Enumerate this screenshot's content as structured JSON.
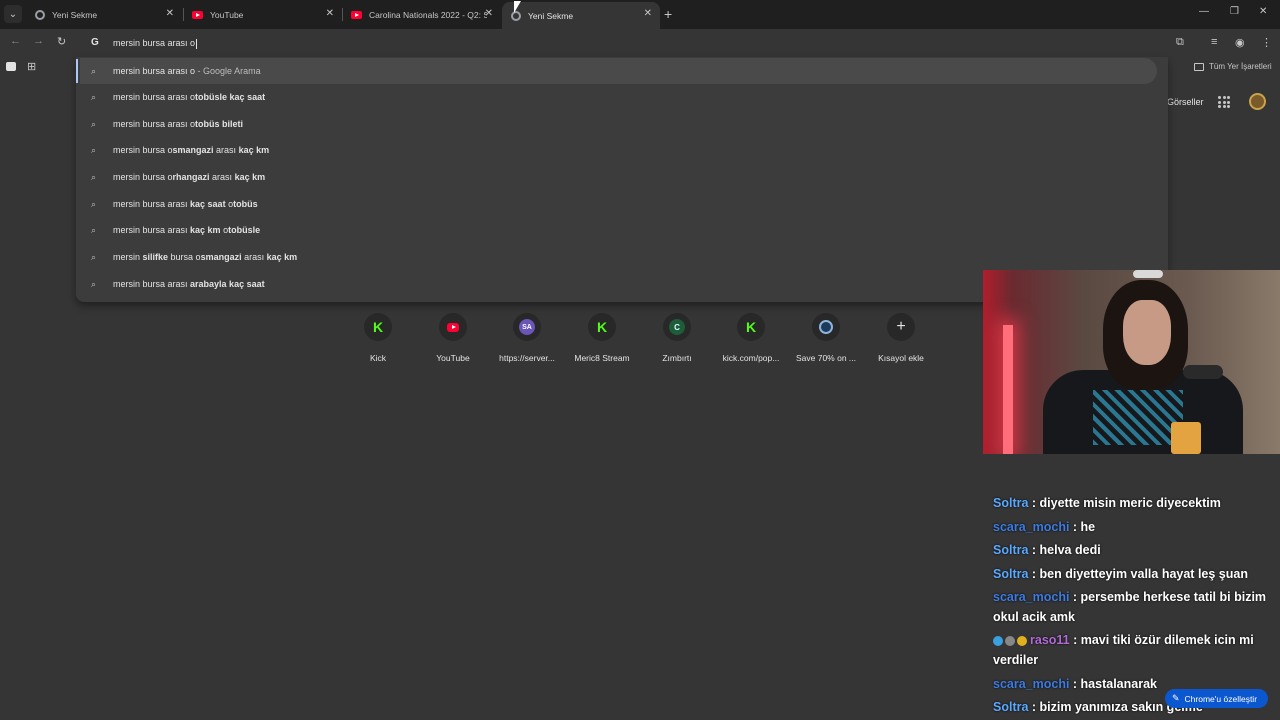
{
  "tabs": [
    {
      "title": "Yeni Sekme",
      "icon": "chrome-icon"
    },
    {
      "title": "YouTube",
      "icon": "youtube-icon"
    },
    {
      "title": "Carolina Nationals 2022 - Q2: S",
      "icon": "youtube-icon"
    },
    {
      "title": "Yeni Sekme",
      "icon": "chrome-icon",
      "active": true
    }
  ],
  "omnibox": {
    "value": "mersin bursa arası o"
  },
  "bookmarks": {
    "all_label": "Tüm Yer İşaretleri"
  },
  "google": {
    "images_label": "Görseller"
  },
  "suggestions": [
    {
      "pre": "mersin bursa arası o",
      "bold": "",
      "mid": "",
      "bold2": "",
      "mid2": "",
      "bold3": "",
      "suffix": " - Google Arama"
    },
    {
      "pre": "mersin bursa arası o",
      "bold": "tobüsle kaç saat",
      "mid": "",
      "bold2": "",
      "mid2": "",
      "bold3": "",
      "suffix": ""
    },
    {
      "pre": "mersin bursa arası o",
      "bold": "tobüs bileti",
      "mid": "",
      "bold2": "",
      "mid2": "",
      "bold3": "",
      "suffix": ""
    },
    {
      "pre": "mersin bursa o",
      "bold": "smangazi",
      "mid": " arası ",
      "bold2": "kaç km",
      "mid2": "",
      "bold3": "",
      "suffix": ""
    },
    {
      "pre": "mersin bursa o",
      "bold": "rhangazi",
      "mid": " arası ",
      "bold2": "kaç km",
      "mid2": "",
      "bold3": "",
      "suffix": ""
    },
    {
      "pre": "mersin bursa arası ",
      "bold": "kaç saat",
      "mid": " o",
      "bold2": "tobüs",
      "mid2": "",
      "bold3": "",
      "suffix": ""
    },
    {
      "pre": "mersin bursa arası ",
      "bold": "kaç km",
      "mid": " o",
      "bold2": "tobüsle",
      "mid2": "",
      "bold3": "",
      "suffix": ""
    },
    {
      "pre": "mersin ",
      "bold": "silifke",
      "mid": " bursa o",
      "bold2": "smangazi",
      "mid2": " arası ",
      "bold3": "kaç km",
      "suffix": ""
    },
    {
      "pre": "mersin bursa arası ",
      "bold": "arabayla kaç saat",
      "mid": "",
      "bold2": "",
      "mid2": "",
      "bold3": "",
      "suffix": ""
    }
  ],
  "shortcuts": [
    {
      "label": "Kick",
      "icon": "kick-icon",
      "glyph": "K"
    },
    {
      "label": "YouTube",
      "icon": "youtube-icon",
      "glyph": ""
    },
    {
      "label": "https://server...",
      "icon": "sa-icon",
      "glyph": "SA"
    },
    {
      "label": "Meric8 Stream",
      "icon": "kick-icon",
      "glyph": "K"
    },
    {
      "label": "Zımbırtı",
      "icon": "c-icon",
      "glyph": "C"
    },
    {
      "label": "kick.com/pop...",
      "icon": "kick-icon",
      "glyph": "K"
    },
    {
      "label": "Save 70% on ...",
      "icon": "steam-icon",
      "glyph": ""
    },
    {
      "label": "Kısayol ekle",
      "icon": "plus-icon",
      "glyph": "+"
    }
  ],
  "chat": [
    {
      "user": "Soltra",
      "color": "#5aa9ff",
      "message": "diyette misin meric diyecektim"
    },
    {
      "user": "scara_mochi",
      "color": "#3c7be0",
      "message": "he"
    },
    {
      "user": "Soltra",
      "color": "#5aa9ff",
      "message": "helva dedi"
    },
    {
      "user": "Soltra",
      "color": "#5aa9ff",
      "message": "ben diyetteyim valla hayat leş şuan"
    },
    {
      "user": "scara_mochi",
      "color": "#3c7be0",
      "message": "persembe herkese tatil bi bizim okul acik amk"
    },
    {
      "user": "raso11",
      "color": "#b16ad8",
      "message": "mavi tiki özür dilemek icin mi verdiler",
      "badges": true
    },
    {
      "user": "scara_mochi",
      "color": "#3c7be0",
      "message": "hastalanarak"
    },
    {
      "user": "Soltra",
      "color": "#5aa9ff",
      "message": "bizim yanımıza sakın gelme"
    }
  ],
  "customize_label": "Chrome'u özelleştir",
  "colors": {
    "kick_green": "#53fc18",
    "youtube_red": "#ff0033",
    "accent_blue": "#0b57d0"
  }
}
